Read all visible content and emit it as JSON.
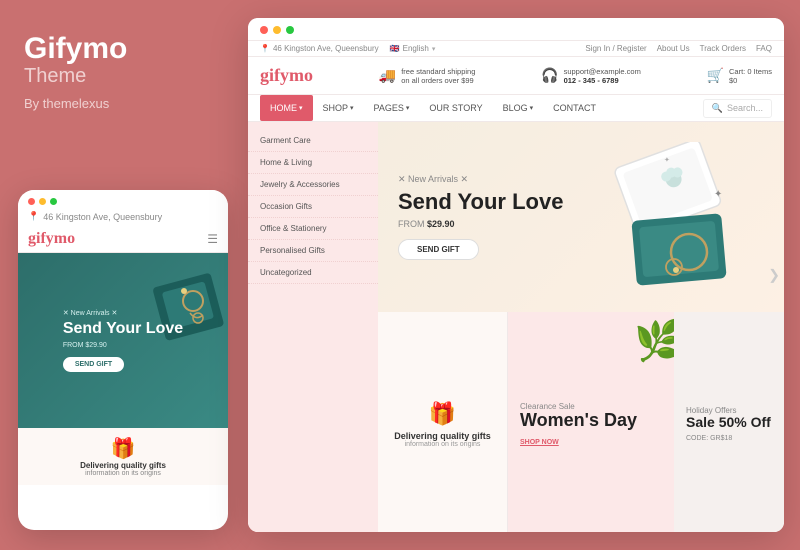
{
  "brand": {
    "name": "Gifymo",
    "subtitle": "Theme",
    "by": "By themelexus",
    "color": "#c97070"
  },
  "desktop": {
    "utility_bar": {
      "address": "46 Kingston Ave, Queensbury",
      "language": "English",
      "sign_in": "Sign In / Register",
      "about_us": "About Us",
      "track_orders": "Track Orders",
      "faq": "FAQ"
    },
    "header": {
      "logo": "gifymo",
      "shipping_label": "free standard shipping",
      "shipping_sub": "on all orders over $99",
      "support_label": "support@example.com",
      "support_phone": "012 - 345 - 6789",
      "cart_label": "Cart:",
      "cart_items": "0 Items",
      "cart_total": "$0"
    },
    "nav": {
      "items": [
        {
          "label": "HOME",
          "active": true
        },
        {
          "label": "SHOP",
          "has_dropdown": true
        },
        {
          "label": "PAGES",
          "has_dropdown": true
        },
        {
          "label": "OUR STORY"
        },
        {
          "label": "BLOG",
          "has_dropdown": true
        },
        {
          "label": "CONTACT"
        }
      ],
      "search_placeholder": "Search..."
    },
    "sidebar": {
      "items": [
        "Garment Care",
        "Home & Living",
        "Jewelry & Accessories",
        "Occasion Gifts",
        "Office & Stationery",
        "Personalised Gifts",
        "Uncategorized"
      ]
    },
    "hero": {
      "new_arrivals": "✕ New Arrivals ✕",
      "title_line1": "Send Your Love",
      "from_label": "FROM",
      "from_price": "$29.90",
      "cta_button": "SEND GIFT"
    },
    "quality_panel": {
      "title": "Delivering quality gifts",
      "subtitle": "information on its origins"
    },
    "womens_panel": {
      "clearance": "Clearance Sale",
      "title": "Women's Day",
      "cta": "SHOP NOW"
    },
    "holiday_panel": {
      "label": "Holiday Offers",
      "title": "Sale 50% Off",
      "code": "CODE: GR$18"
    }
  },
  "mobile": {
    "address": "46 Kingston Ave, Queensbury",
    "logo": "gifymo",
    "hero": {
      "new_arrivals": "✕ New Arrivals ✕",
      "title": "Send Your Love",
      "from": "FROM   $29.90",
      "cta": "SEND GIFT"
    },
    "quality": {
      "title": "Delivering quality gifts",
      "subtitle": "information on its origins"
    }
  }
}
